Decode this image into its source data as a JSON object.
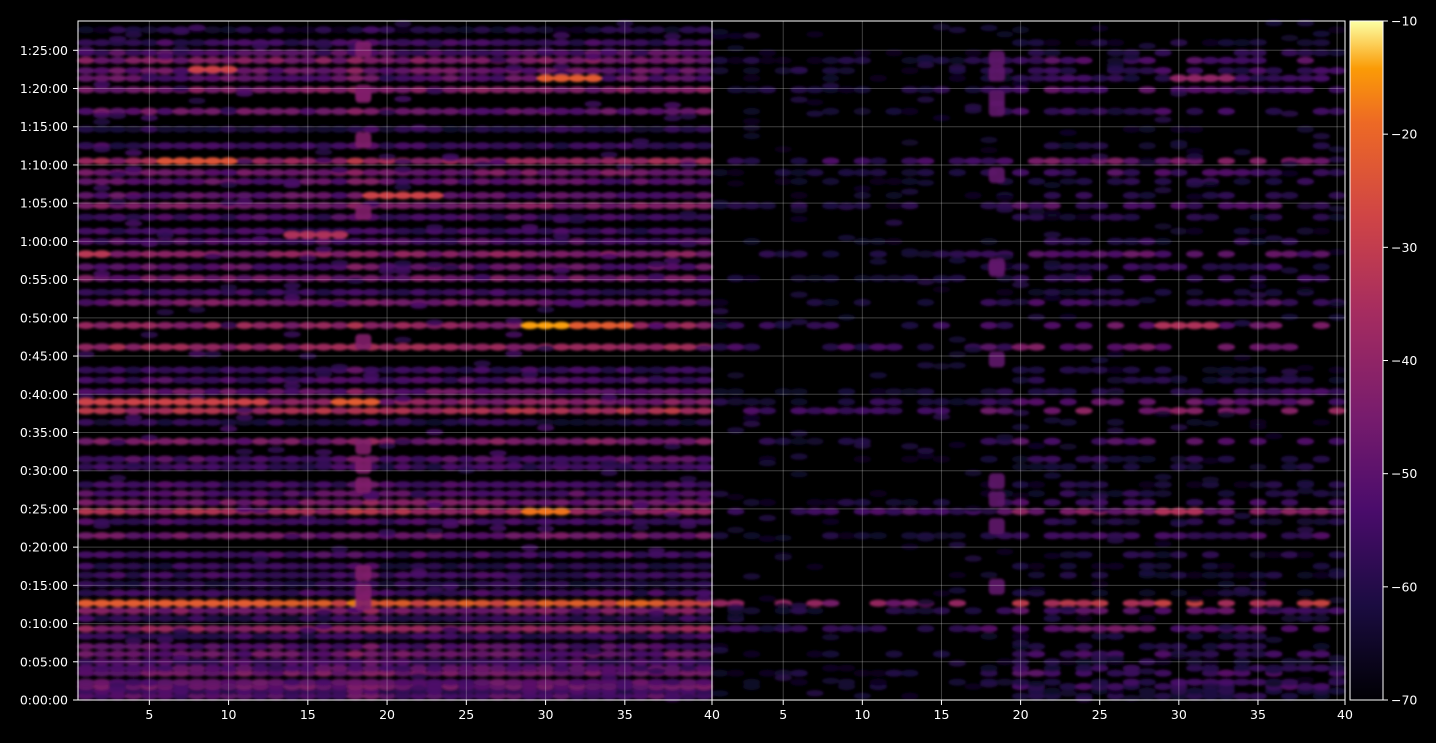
{
  "chart_data": {
    "type": "heatmap",
    "background": "#000000",
    "colormap": "inferno",
    "grid": true,
    "panels": [
      {
        "name": "",
        "x_ticks": [
          "5",
          "10",
          "15",
          "20",
          "25",
          "30",
          "35",
          "40"
        ],
        "x_tick_values": [
          5,
          10,
          15,
          20,
          25,
          30,
          35,
          40
        ],
        "xlim": [
          1,
          40
        ],
        "intensity_scale": 1.0
      },
      {
        "name": "",
        "x_ticks": [
          "5",
          "10",
          "15",
          "20",
          "25",
          "30",
          "35",
          "40"
        ],
        "x_tick_values": [
          5,
          10,
          15,
          20,
          25,
          30,
          35,
          40
        ],
        "xlim": [
          1,
          40
        ],
        "intensity_scale": 0.75
      }
    ],
    "y_ticks": [
      "0:00:00",
      "0:05:00",
      "0:10:00",
      "0:15:00",
      "0:20:00",
      "0:25:00",
      "0:30:00",
      "0:35:00",
      "0:40:00",
      "0:45:00",
      "0:50:00",
      "0:55:00",
      "1:00:00",
      "1:05:00",
      "1:10:00",
      "1:15:00",
      "1:20:00",
      "1:25:00"
    ],
    "y_tick_values_seconds": [
      0,
      300,
      600,
      900,
      1200,
      1500,
      1800,
      2100,
      2400,
      2700,
      3000,
      3300,
      3600,
      3900,
      4200,
      4500,
      4800,
      5100
    ],
    "ylim_seconds": [
      0,
      5330
    ],
    "colorbar": {
      "ticks": [
        "−10",
        "−20",
        "−30",
        "−40",
        "−50",
        "−60",
        "−70"
      ],
      "tick_values": [
        -10,
        -20,
        -30,
        -40,
        -50,
        -60,
        -70
      ],
      "range": [
        -70,
        -10
      ]
    },
    "rows": [
      {
        "t": 30,
        "v": -52
      },
      {
        "t": 70,
        "v": -55
      },
      {
        "t": 105,
        "v": -48
      },
      {
        "t": 140,
        "v": -50
      },
      {
        "t": 210,
        "v": -46
      },
      {
        "t": 250,
        "v": -52
      },
      {
        "t": 300,
        "v": -54
      },
      {
        "t": 360,
        "v": -48
      },
      {
        "t": 420,
        "v": -52
      },
      {
        "t": 500,
        "v": -56
      },
      {
        "t": 560,
        "v": -40
      },
      {
        "t": 640,
        "v": -58
      },
      {
        "t": 700,
        "v": -44
      },
      {
        "t": 760,
        "v": -24
      },
      {
        "t": 840,
        "v": -56
      },
      {
        "t": 910,
        "v": -60
      },
      {
        "t": 980,
        "v": -56
      },
      {
        "t": 1050,
        "v": -58
      },
      {
        "t": 1140,
        "v": -54
      },
      {
        "t": 1290,
        "v": -46
      },
      {
        "t": 1400,
        "v": -54
      },
      {
        "t": 1480,
        "v": -36
      },
      {
        "t": 1550,
        "v": -46
      },
      {
        "t": 1620,
        "v": -52
      },
      {
        "t": 1690,
        "v": -54
      },
      {
        "t": 1830,
        "v": -56
      },
      {
        "t": 1890,
        "v": -52
      },
      {
        "t": 2030,
        "v": -44
      },
      {
        "t": 2180,
        "v": -60
      },
      {
        "t": 2270,
        "v": -34
      },
      {
        "t": 2340,
        "v": -42
      },
      {
        "t": 2420,
        "v": -48
      },
      {
        "t": 2510,
        "v": -54
      },
      {
        "t": 2590,
        "v": -56
      },
      {
        "t": 2770,
        "v": -38
      },
      {
        "t": 2940,
        "v": -40
      },
      {
        "t": 3120,
        "v": -46
      },
      {
        "t": 3200,
        "v": -56
      },
      {
        "t": 3310,
        "v": -46
      },
      {
        "t": 3400,
        "v": -50
      },
      {
        "t": 3500,
        "v": -42
      },
      {
        "t": 3600,
        "v": -52
      },
      {
        "t": 3680,
        "v": -56
      },
      {
        "t": 3790,
        "v": -54
      },
      {
        "t": 3880,
        "v": -44
      },
      {
        "t": 3960,
        "v": -50
      },
      {
        "t": 4070,
        "v": -50
      },
      {
        "t": 4140,
        "v": -46
      },
      {
        "t": 4230,
        "v": -38
      },
      {
        "t": 4350,
        "v": -56
      },
      {
        "t": 4480,
        "v": -60
      },
      {
        "t": 4620,
        "v": -48
      },
      {
        "t": 4790,
        "v": -44
      },
      {
        "t": 4880,
        "v": -50
      },
      {
        "t": 4940,
        "v": -48
      },
      {
        "t": 5020,
        "v": -44
      },
      {
        "t": 5080,
        "v": -52
      },
      {
        "t": 5160,
        "v": -56
      },
      {
        "t": 5260,
        "v": -62
      }
    ],
    "hotspots": [
      {
        "panel": 0,
        "t": 760,
        "x": [
          1,
          12
        ],
        "v": -22
      },
      {
        "panel": 0,
        "t": 2940,
        "x": [
          29,
          31
        ],
        "v": -14
      },
      {
        "panel": 0,
        "t": 2940,
        "x": [
          32,
          35
        ],
        "v": -22
      },
      {
        "panel": 0,
        "t": 1480,
        "x": [
          29,
          31
        ],
        "v": -18
      },
      {
        "panel": 0,
        "t": 4880,
        "x": [
          30,
          33
        ],
        "v": -22
      },
      {
        "panel": 0,
        "t": 4950,
        "x": [
          8,
          10
        ],
        "v": -28
      },
      {
        "panel": 0,
        "t": 4230,
        "x": [
          6,
          10
        ],
        "v": -24
      },
      {
        "panel": 0,
        "t": 3960,
        "x": [
          19,
          23
        ],
        "v": -28
      },
      {
        "panel": 0,
        "t": 2340,
        "x": [
          1,
          12
        ],
        "v": -28
      },
      {
        "panel": 0,
        "t": 2340,
        "x": [
          17,
          19
        ],
        "v": -22
      },
      {
        "panel": 0,
        "t": 3500,
        "x": [
          1,
          2
        ],
        "v": -32
      },
      {
        "panel": 0,
        "t": 3650,
        "x": [
          14,
          17
        ],
        "v": -34
      },
      {
        "panel": 1,
        "t": 2940,
        "x": [
          29,
          32
        ],
        "v": -34
      },
      {
        "panel": 1,
        "t": 1480,
        "x": [
          29,
          31
        ],
        "v": -34
      },
      {
        "panel": 1,
        "t": 4880,
        "x": [
          30,
          33
        ],
        "v": -40
      }
    ],
    "vertical_band": {
      "x": 18.5,
      "extra": 12
    }
  }
}
